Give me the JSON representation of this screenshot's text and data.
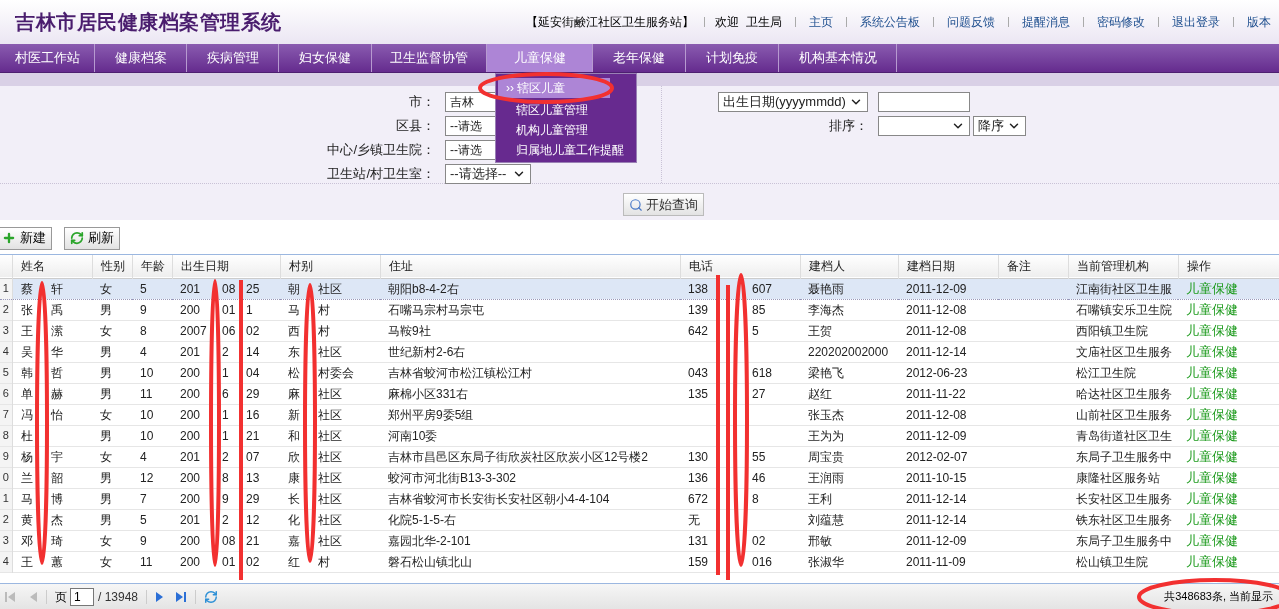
{
  "header": {
    "title": "吉林市居民健康档案管理系统",
    "station": "【延安街鹸江社区卫生服务站】",
    "welcome": "欢迎  卫生局",
    "links": [
      "主页",
      "系统公告板",
      "问题反馈",
      "提醒消息",
      "密码修改",
      "退出登录",
      "版本"
    ]
  },
  "nav": [
    {
      "label": "村医工作站",
      "selected": false
    },
    {
      "label": "健康档案",
      "selected": false
    },
    {
      "label": "疾病管理",
      "selected": false
    },
    {
      "label": "妇女保健",
      "selected": false
    },
    {
      "label": "卫生监督协管",
      "selected": false
    },
    {
      "label": "儿童保健",
      "selected": true
    },
    {
      "label": "老年保健",
      "selected": false
    },
    {
      "label": "计划免疫",
      "selected": false
    },
    {
      "label": "机构基本情况",
      "selected": false
    }
  ],
  "dropdown": [
    {
      "label": "›› 辖区儿童",
      "selected": true
    },
    {
      "label": "辖区儿童管理",
      "selected": false
    },
    {
      "label": "机构儿童管理",
      "selected": false
    },
    {
      "label": "归属地儿童工作提醒",
      "selected": false
    }
  ],
  "filters": {
    "left": [
      {
        "label": "市：",
        "value": "吉林"
      },
      {
        "label": "区县：",
        "value": "--请选"
      },
      {
        "label": "中心/乡镇卫生院：",
        "value": "--请选"
      },
      {
        "label": "卫生站/村卫生室：",
        "value": "--请选择--"
      }
    ],
    "date_field": "出生日期(yyyymmdd)",
    "sort_label": "排序：",
    "sort_order": "降序",
    "query_button": "开始查询"
  },
  "toolbar": [
    "新建",
    "刷新"
  ],
  "table": {
    "columns": [
      "姓名",
      "性别",
      "年龄",
      "出生日期",
      "村别",
      "住址",
      "电话",
      "建档人",
      "建档日期",
      "备注",
      "当前管理机构",
      "操作"
    ],
    "rows": [
      {
        "index": "1",
        "selected": true,
        "name": [
          "蔡",
          "轩"
        ],
        "sex": "女",
        "age": "5",
        "birth": [
          "201",
          "08",
          "25"
        ],
        "village": [
          "朝",
          "社区"
        ],
        "address": "朝阳b8-4-2右",
        "phone": [
          "138",
          "607"
        ],
        "creator": "聂艳雨",
        "created": "2011-12-09",
        "org": "江南街社区卫生服",
        "action": "儿童保健"
      },
      {
        "index": "2",
        "selected": false,
        "name": [
          "张",
          "禹"
        ],
        "sex": "男",
        "age": "9",
        "birth": [
          "200",
          "01",
          "1"
        ],
        "village": [
          "马",
          "村"
        ],
        "address": "石嘴马宗村马宗屯",
        "phone": [
          "139",
          "85"
        ],
        "creator": "李海杰",
        "created": "2011-12-08",
        "org": "石嘴镇安乐卫生院",
        "action": "儿童保健"
      },
      {
        "index": "3",
        "selected": false,
        "name": [
          "王",
          "潆"
        ],
        "sex": "女",
        "age": "8",
        "birth": [
          "2007",
          "06",
          "02"
        ],
        "village": [
          "西",
          "村"
        ],
        "address": "马鞍9社",
        "phone": [
          "642",
          "5"
        ],
        "creator": "王贺",
        "created": "2011-12-08",
        "org": "西阳镇卫生院",
        "action": "儿童保健"
      },
      {
        "index": "4",
        "selected": false,
        "name": [
          "吴",
          "华"
        ],
        "sex": "男",
        "age": "4",
        "birth": [
          "201",
          "2",
          "14"
        ],
        "village": [
          "东",
          "社区"
        ],
        "address": "世纪新村2-6右",
        "phone": [],
        "creator": "220202002000",
        "created": "2011-12-14",
        "org": "文庙社区卫生服务",
        "action": "儿童保健"
      },
      {
        "index": "5",
        "selected": false,
        "name": [
          "韩",
          "哲"
        ],
        "sex": "男",
        "age": "10",
        "birth": [
          "200",
          "1",
          "04"
        ],
        "village": [
          "松",
          "村委会"
        ],
        "address": "吉林省蛟河市松江镇松江村",
        "phone": [
          "043",
          "618"
        ],
        "creator": "梁艳飞",
        "created": "2012-06-23",
        "org": "松江卫生院",
        "action": "儿童保健"
      },
      {
        "index": "6",
        "selected": false,
        "name": [
          "单",
          "赫"
        ],
        "sex": "男",
        "age": "11",
        "birth": [
          "200",
          "6",
          "29"
        ],
        "village": [
          "麻",
          "社区"
        ],
        "address": "麻棉小区331右",
        "phone": [
          "135",
          "27"
        ],
        "creator": "赵红",
        "created": "2011-11-22",
        "org": "哈达社区卫生服务",
        "action": "儿童保健"
      },
      {
        "index": "7",
        "selected": false,
        "name": [
          "冯",
          "怡"
        ],
        "sex": "女",
        "age": "10",
        "birth": [
          "200",
          "1",
          "16"
        ],
        "village": [
          "新",
          "社区"
        ],
        "address": "郑州平房9委5组",
        "phone": [],
        "creator": "张玉杰",
        "created": "2011-12-08",
        "org": "山前社区卫生服务",
        "action": "儿童保健"
      },
      {
        "index": "8",
        "selected": false,
        "name": [
          "杜"
        ],
        "sex": "男",
        "age": "10",
        "birth": [
          "200",
          "1",
          "21"
        ],
        "village": [
          "和",
          "社区"
        ],
        "address": "河南10委",
        "phone": [],
        "creator": "王为为",
        "created": "2011-12-09",
        "org": "青岛街道社区卫生",
        "action": "儿童保健"
      },
      {
        "index": "9",
        "selected": false,
        "name": [
          "杨",
          "宇"
        ],
        "sex": "女",
        "age": "4",
        "birth": [
          "201",
          "2",
          "07"
        ],
        "village": [
          "欣",
          "社区"
        ],
        "address": "吉林市昌邑区东局子街欣炭社区欣炭小区12号楼2",
        "phone": [
          "130",
          "55"
        ],
        "creator": "周宝贵",
        "created": "2012-02-07",
        "org": "东局子卫生服务中",
        "action": "儿童保健"
      },
      {
        "index": "0",
        "selected": false,
        "name": [
          "兰",
          "韶"
        ],
        "sex": "男",
        "age": "12",
        "birth": [
          "200",
          "8",
          "13"
        ],
        "village": [
          "康",
          "社区"
        ],
        "address": "蛟河市河北街B13-3-302",
        "phone": [
          "136",
          "46"
        ],
        "creator": "王润雨",
        "created": "2011-10-15",
        "org": "康隆社区服务站",
        "action": "儿童保健"
      },
      {
        "index": "1",
        "selected": false,
        "name": [
          "马",
          "博"
        ],
        "sex": "男",
        "age": "7",
        "birth": [
          "200",
          "9",
          "29"
        ],
        "village": [
          "长",
          "社区"
        ],
        "address": "吉林省蛟河市长安街长安社区朝小4-4-104",
        "phone": [
          "672",
          "8"
        ],
        "creator": "王利",
        "created": "2011-12-14",
        "org": "长安社区卫生服务",
        "action": "儿童保健"
      },
      {
        "index": "2",
        "selected": false,
        "name": [
          "黄",
          "杰"
        ],
        "sex": "男",
        "age": "5",
        "birth": [
          "201",
          "2",
          "12"
        ],
        "village": [
          "化",
          "社区"
        ],
        "address": "化院5-1-5-右",
        "phone": [
          "无"
        ],
        "creator": "刘蕴慧",
        "created": "2011-12-14",
        "org": "铁东社区卫生服务",
        "action": "儿童保健"
      },
      {
        "index": "3",
        "selected": false,
        "name": [
          "邓",
          "琦"
        ],
        "sex": "女",
        "age": "9",
        "birth": [
          "200",
          "08",
          "21"
        ],
        "village": [
          "嘉",
          "社区"
        ],
        "address": "嘉园北华-2-101",
        "phone": [
          "131",
          "02"
        ],
        "creator": "邢敏",
        "created": "2011-12-09",
        "org": "东局子卫生服务中",
        "action": "儿童保健"
      },
      {
        "index": "4",
        "selected": false,
        "name": [
          "王",
          "蕙"
        ],
        "sex": "女",
        "age": "11",
        "birth": [
          "200",
          "01",
          "02"
        ],
        "village": [
          "红",
          "村"
        ],
        "address": "磐石松山镇北山",
        "phone": [
          "159",
          "016"
        ],
        "creator": "张淑华",
        "created": "2011-11-09",
        "org": "松山镇卫生院",
        "action": "儿童保健"
      }
    ]
  },
  "pager": {
    "page_label": "页",
    "page": "1",
    "total_pages": "/ 13948",
    "summary": "共348683条, 当前显示"
  }
}
